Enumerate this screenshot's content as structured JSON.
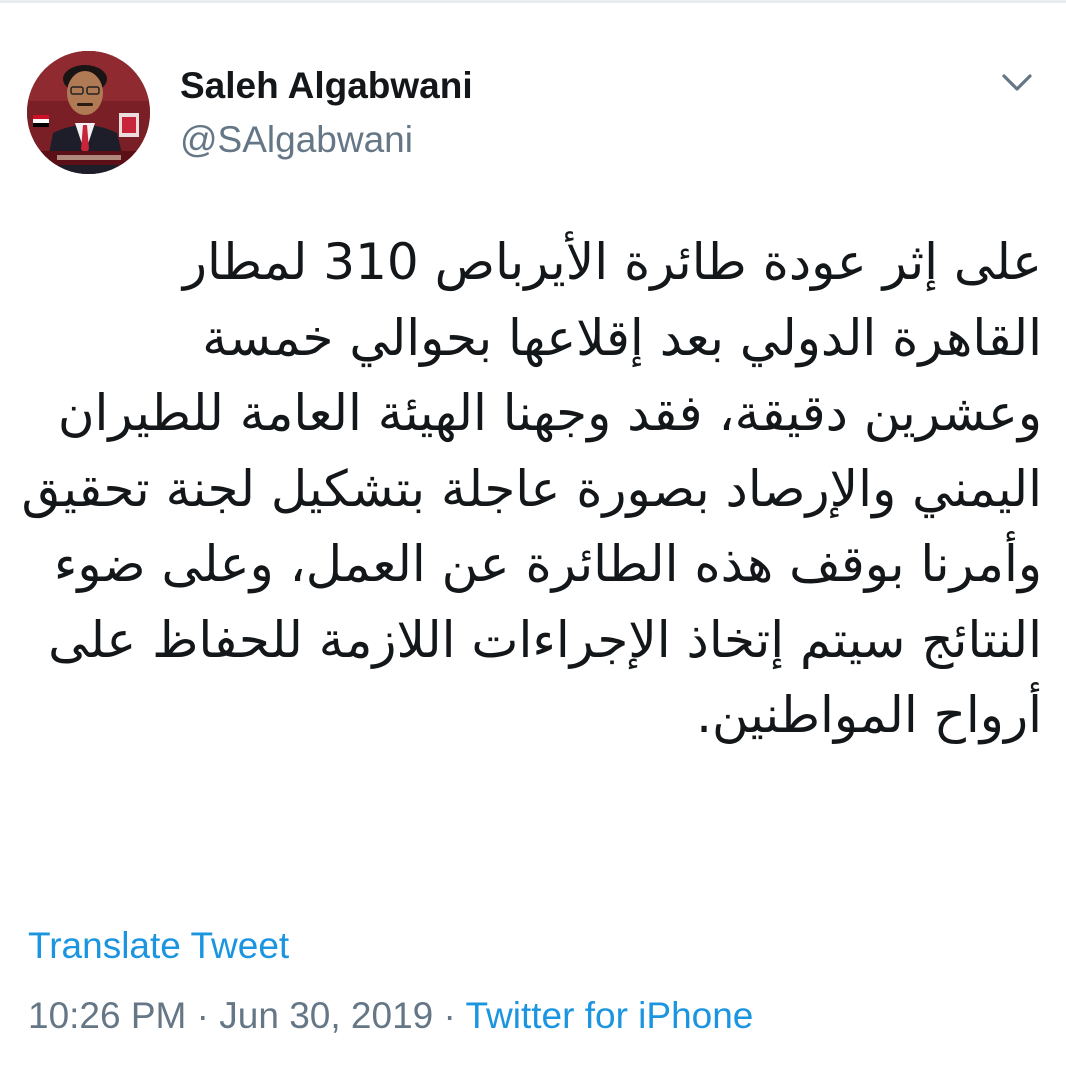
{
  "user": {
    "display_name": "Saleh Algabwani",
    "handle": "@SAlgabwani"
  },
  "tweet": {
    "text": "على إثر عودة طائرة الأيرباص 310 لمطار القاهرة الدولي بعد إقلاعها بحوالي خمسة وعشرين دقيقة، فقد وجهنا الهيئة العامة للطيران اليمني والإرصاد بصورة عاجلة بتشكيل لجنة تحقيق وأمرنا بوقف هذه الطائرة عن العمل، وعلى ضوء النتائج سيتم إتخاذ الإجراءات اللازمة للحفاظ على أرواح المواطنين.",
    "translate_label": "Translate Tweet",
    "time": "10:26 PM",
    "separator": "·",
    "date": "Jun 30, 2019",
    "source": "Twitter for iPhone"
  },
  "icons": {
    "caret": "chevron-down-icon",
    "avatar": "avatar"
  },
  "colors": {
    "link": "#1b95e0",
    "secondary": "#657786",
    "text": "#14171a",
    "caret": "#657786"
  }
}
